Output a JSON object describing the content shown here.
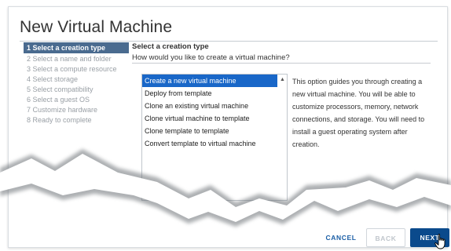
{
  "dialog": {
    "title": "New Virtual Machine"
  },
  "steps": [
    {
      "label": "1 Select a creation type"
    },
    {
      "label": "2 Select a name and folder"
    },
    {
      "label": "3 Select a compute resource"
    },
    {
      "label": "4 Select storage"
    },
    {
      "label": "5 Select compatibility"
    },
    {
      "label": "6 Select a guest OS"
    },
    {
      "label": "7 Customize hardware"
    },
    {
      "label": "8 Ready to complete"
    }
  ],
  "main": {
    "title": "Select a creation type",
    "question": "How would you like to create a virtual machine?"
  },
  "options": [
    {
      "label": "Create a new virtual machine",
      "selected": true
    },
    {
      "label": "Deploy from template"
    },
    {
      "label": "Clone an existing virtual machine"
    },
    {
      "label": "Clone virtual machine to template"
    },
    {
      "label": "Clone template to template"
    },
    {
      "label": "Convert template to virtual machine"
    }
  ],
  "description": "This option guides you through creating a new virtual machine. You will be able to customize processors, memory, network connections, and storage. You will need to install a guest operating system after creation.",
  "footer": {
    "cancel": "CANCEL",
    "back": "BACK",
    "next": "NEXT"
  },
  "colors": {
    "active_step": "#4a6b8f",
    "selected_option": "#1967c8",
    "primary_button": "#0b4a8c",
    "link": "#1a5ea6"
  },
  "icons": {
    "scroll": "scroll-up-arrow-icon",
    "cursor": "hand-pointer-icon"
  }
}
